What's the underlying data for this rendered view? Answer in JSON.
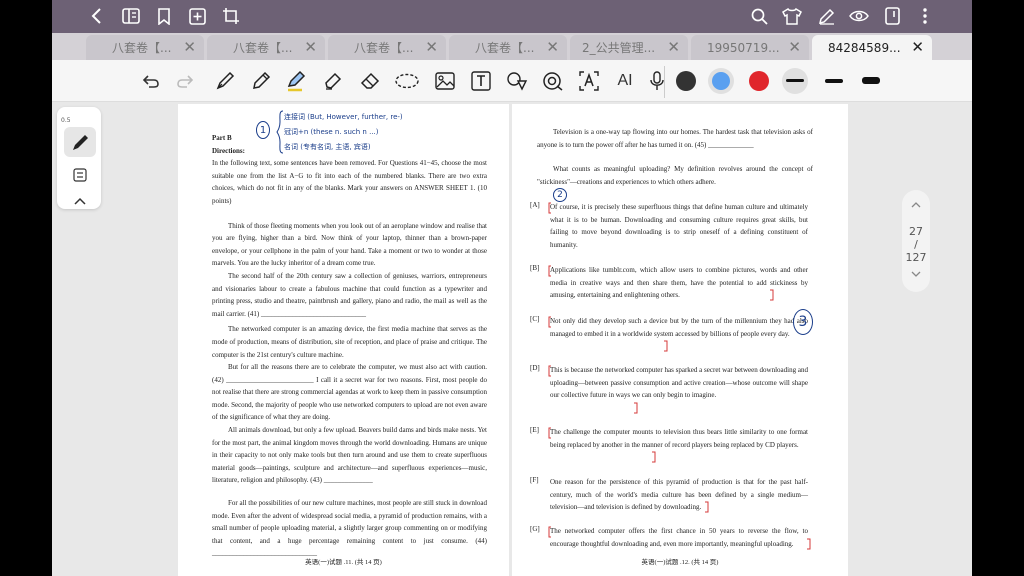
{
  "app": {
    "tabs": [
      {
        "label": "八套卷【..."
      },
      {
        "label": "八套卷【..."
      },
      {
        "label": "八套卷【..."
      },
      {
        "label": "八套卷【..."
      },
      {
        "label": "2_公共管理..."
      },
      {
        "label": "19950719..."
      },
      {
        "label": "84284589..."
      }
    ],
    "tab_count": "25",
    "pen_size": "0.5",
    "page_current": "27",
    "page_sep": "/",
    "page_total": "127",
    "colors": {
      "black": "#333333",
      "blue": "#5aa0f0",
      "red": "#e0262c"
    },
    "toolbar_text_icon": "AI"
  },
  "left_page": {
    "part": "Part B",
    "directions_label": "Directions:",
    "directions": "In the following text, some sentences have been removed. For Questions 41−45, choose the most suitable one from the list A−G to fit into each of the numbered blanks. There are two extra choices, which do not fit in any of the blanks. Mark your answers on ANSWER SHEET 1. (10 points)",
    "para1": "Think of those fleeting moments when you look out of an aeroplane window and realise that you are flying, higher than a bird. Now think of your laptop, thinner than a brown-paper envelope, or your cellphone in the palm of your hand. Take a moment or two to wonder at those marvels. You are the lucky inheritor of a dream come true.",
    "para2": "The second half of the 20th century saw a collection of geniuses, warriors, entrepreneurs and visionaries labour to create a fabulous machine that could function as a typewriter and printing press, studio and theatre, paintbrush and gallery, piano and radio, the mail as well as the mail carrier. (41) ______________________________",
    "para3": "The networked computer is an amazing device, the first media machine that serves as the mode of production, means of distribution, site of reception, and place of praise and critique. The computer is the 21st century's culture machine.",
    "para4": "But for all the reasons there are to celebrate the computer, we must also act with caution. (42) _________________________ I call it a secret war for two reasons. First, most people do not realise that there are strong commercial agendas at work to keep them in passive consumption mode. Second, the majority of people who use networked computers to upload are not even aware of the significance of what they are doing.",
    "para5": "All animals download, but only a few upload. Beavers build dams and birds make nests. Yet for the most part, the animal kingdom moves through the world downloading. Humans are unique in their capacity to not only make tools but then turn around and use them to create superfluous material goods—paintings, sculpture and architecture—and superfluous experiences—music, literature, religion and philosophy. (43) ______________",
    "para6": "For all the possibilities of our new culture machines, most people are still stuck in download mode. Even after the advent of widespread social media, a pyramid of production remains, with a small number of people uploading material, a slightly larger group commenting on or modifying that content, and a huge percentage remaining content to just consume. (44) ______________________________",
    "footer": "英语(一)试题    .11.    (共 14 页)",
    "note1": "连接词 (But, However, further, re-)",
    "note2": "冠词+n (these n. such n ...)",
    "note3": "名词 (专有名词, 主语, 宾语)",
    "circle_label": "1"
  },
  "right_page": {
    "top_para": "Television is a one-way tap flowing into our homes. The hardest task that television asks of anyone is to turn the power off after he has turned it on. (45) _____________",
    "para2": "What counts as meaningful uploading? My definition revolves around the concept of \"stickiness\"—creations and experiences to which others adhere.",
    "options": [
      {
        "label": "[A]",
        "text": "Of course, it is precisely these superfluous things that define human culture and ultimately what it is to be human. Downloading and consuming culture requires great skills, but failing to move beyond downloading is to strip oneself of a defining constituent of humanity."
      },
      {
        "label": "[B]",
        "text": "Applications like tumblr.com, which allow users to combine pictures, words and other media in creative ways and then share them, have the potential to add stickiness by amusing, entertaining and enlightening others."
      },
      {
        "label": "[C]",
        "text": "Not only did they develop such a device but by the turn of the millennium they had also managed to embed it in a worldwide system accessed by billions of people every day."
      },
      {
        "label": "[D]",
        "text": "This is because the networked computer has sparked a secret war between downloading and uploading—between passive consumption and active creation—whose outcome will shape our collective future in ways we can only begin to imagine."
      },
      {
        "label": "[E]",
        "text": "The challenge the computer mounts to television thus bears little similarity to one format being replaced by another in the manner of record players being replaced by CD players."
      },
      {
        "label": "[F]",
        "text": "One reason for the persistence of this pyramid of production is that for the past half-century, much of the world's media culture has been defined by a single medium—television—and television is defined by downloading."
      },
      {
        "label": "[G]",
        "text": "The networked computer offers the first chance in 50 years to reverse the flow, to encourage thoughtful downloading and, even more importantly, meaningful uploading."
      }
    ],
    "footer": "英语(一)试题    .12.    (共 14 页)",
    "circle_2": "2",
    "circle_3": "3"
  }
}
